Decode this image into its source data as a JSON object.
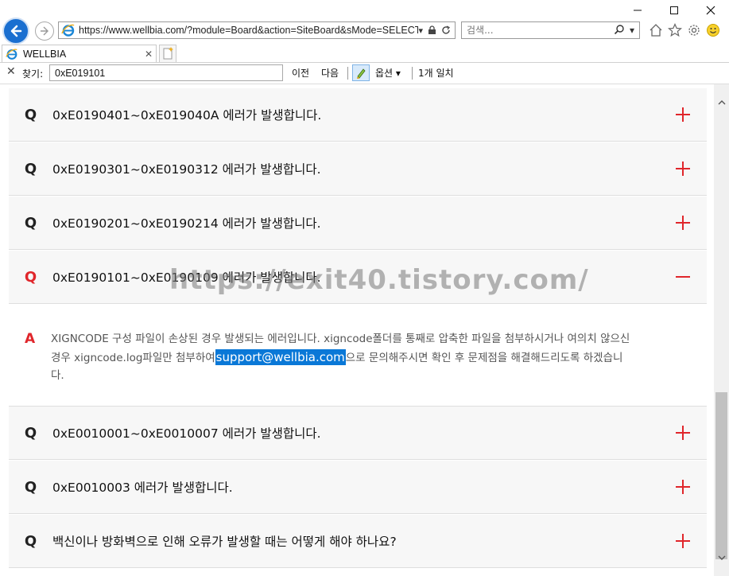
{
  "window": {
    "controls": [
      "minimize",
      "maximize",
      "close"
    ]
  },
  "navigation": {
    "url": "https://www.wellbia.com/?module=Board&action=SiteBoard&sMode=SELECT_",
    "search_placeholder": "검색..."
  },
  "tab": {
    "title": "WELLBIA"
  },
  "find_bar": {
    "label": "찾기:",
    "query": "0xE019101",
    "prev_label": "이전",
    "next_label": "다음",
    "options_label": "옵션",
    "result_text": "1개 일치"
  },
  "faq": {
    "q_marker": "Q",
    "a_marker": "A",
    "items_above": [
      {
        "title": "0xE0190401~0xE019040A 에러가 발생합니다."
      },
      {
        "title": "0xE0190301~0xE0190312 에러가 발생합니다."
      },
      {
        "title": "0xE0190201~0xE0190214 에러가 발생합니다."
      }
    ],
    "open_item": {
      "title": "0xE0190101~0xE0190109 에러가 발생합니다.",
      "answer_before": "XIGNCODE 구성 파일이 손상된 경우 발생되는 에러입니다. xigncode폴더를 통째로 압축한 파일을 첨부하시거나 여의치 않으신 경우 xigncode.log파일만 첨부하여",
      "answer_email": "support@wellbia.com",
      "answer_after": "으로 문의해주시면 확인 후 문제점을 해결해드리도록 하겠습니다."
    },
    "items_below": [
      {
        "title": "0xE0010001~0xE0010007 에러가 발생합니다."
      },
      {
        "title": "0xE0010003 에러가 발생합니다."
      },
      {
        "title": "백신이나 방화벽으로 인해 오류가 발생할 때는 어떻게 해야 하나요?"
      }
    ]
  },
  "watermark": "https://exit40.tistory.com/",
  "colors": {
    "accent_red": "#e0262b",
    "highlight_blue": "#0a78d7",
    "row_bg": "#f7f7f7"
  }
}
